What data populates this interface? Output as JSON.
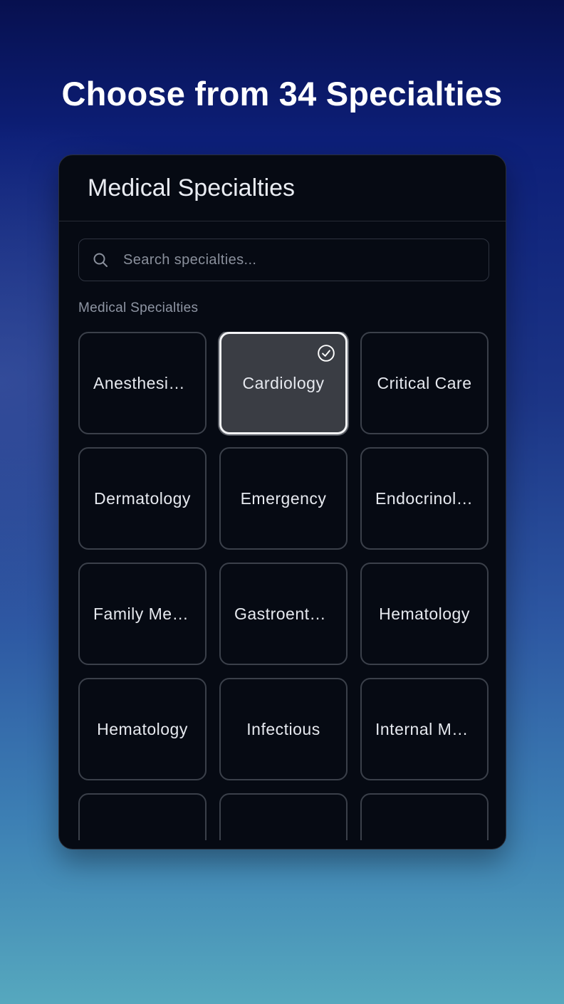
{
  "headline": "Choose from 34 Specialties",
  "panel": {
    "title": "Medical Specialties",
    "search": {
      "placeholder": "Search specialties...",
      "value": ""
    },
    "section_label": "Medical Specialties",
    "tiles": [
      {
        "label": "Anesthesiology",
        "selected": false
      },
      {
        "label": "Cardiology",
        "selected": true
      },
      {
        "label": "Critical Care",
        "selected": false
      },
      {
        "label": "Dermatology",
        "selected": false
      },
      {
        "label": "Emergency",
        "selected": false
      },
      {
        "label": "Endocrinology",
        "selected": false
      },
      {
        "label": "Family Medicine",
        "selected": false
      },
      {
        "label": "Gastroenterology",
        "selected": false
      },
      {
        "label": "Hematology",
        "selected": false
      },
      {
        "label": "Hematology",
        "selected": false
      },
      {
        "label": "Infectious",
        "selected": false
      },
      {
        "label": "Internal Medicine",
        "selected": false
      },
      {
        "label": "",
        "selected": false
      },
      {
        "label": "",
        "selected": false
      },
      {
        "label": "",
        "selected": false
      }
    ]
  },
  "icons": {
    "search": "search-icon",
    "selected": "check-circle-icon"
  },
  "colors": {
    "panel_bg": "#060a13",
    "tile_border": "#3b404a",
    "selected_bg": "#3a3d44",
    "selected_border": "#f2f3f5"
  }
}
